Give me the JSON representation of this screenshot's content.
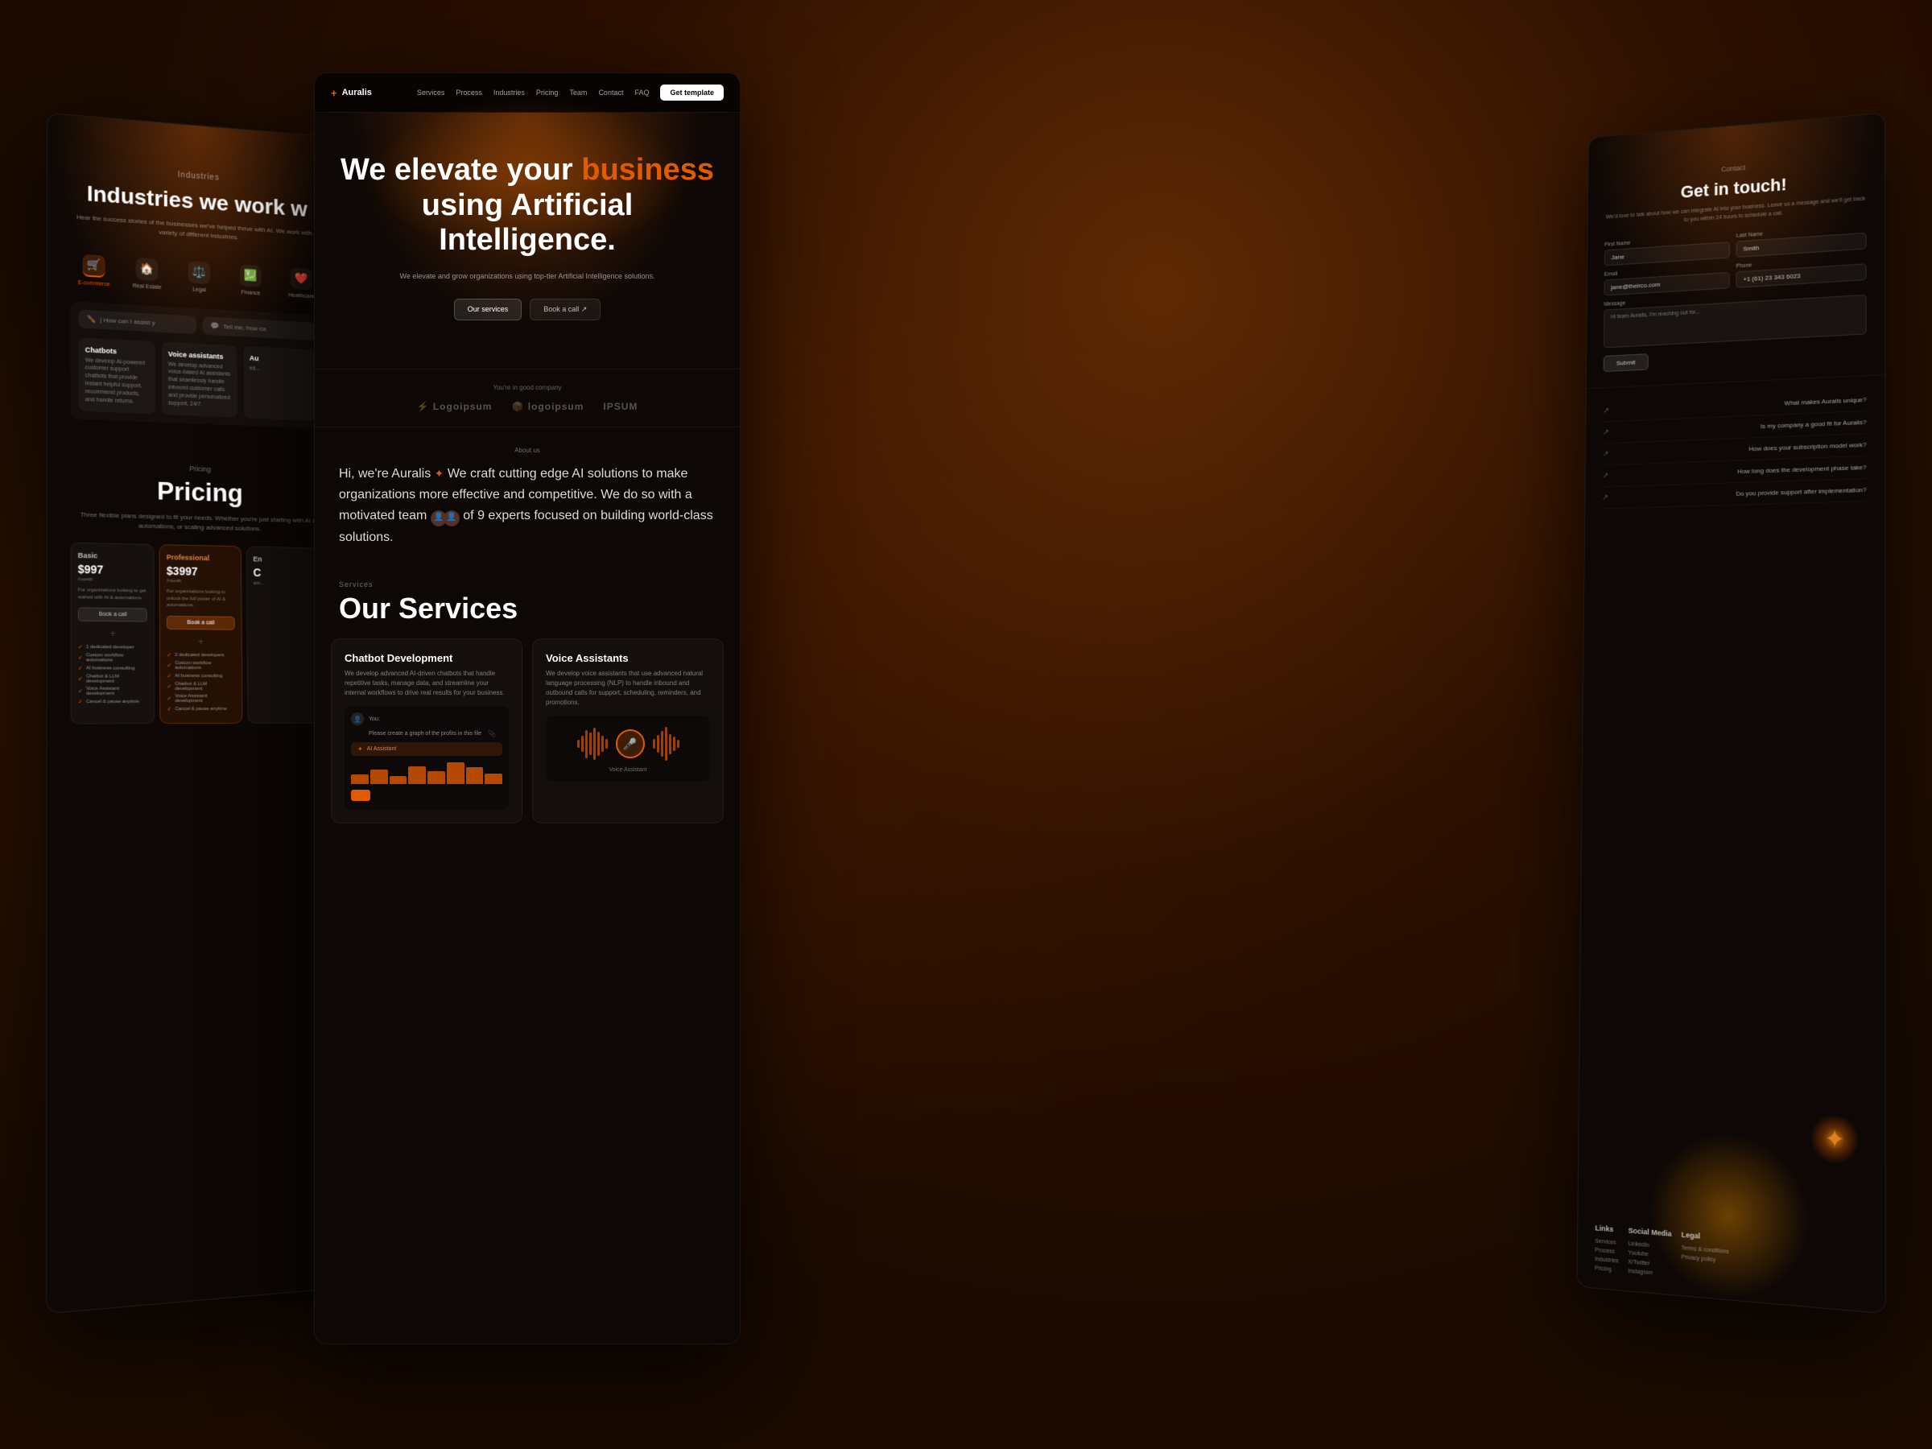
{
  "bg": {
    "desc": "Dark warm background with orange-brown glow"
  },
  "left_card": {
    "industries": {
      "label": "Industries",
      "title": "Industries we work w",
      "subtitle": "Hear the success stories of the businesses we've helped thrive with AI. We work with a variety of different industries.",
      "tabs": [
        {
          "label": "E-commerce",
          "icon": "🛒",
          "active": true
        },
        {
          "label": "Real Estate",
          "icon": "🏠",
          "active": false
        },
        {
          "label": "Legal",
          "icon": "⚖️",
          "active": false
        },
        {
          "label": "Finance",
          "icon": "💹",
          "active": false
        },
        {
          "label": "Healthcare",
          "icon": "❤️",
          "active": false
        }
      ],
      "chat_inputs": [
        {
          "icon": "✏️",
          "text": "| How can I assist y"
        },
        {
          "icon": "💬",
          "text": "Tell me, how ca"
        }
      ]
    },
    "services": {
      "chatbots": {
        "title": "Chatbots",
        "desc": "We develop AI-powered customer support chatbots that provide instant helpful support, recommend products, and handle returns."
      },
      "voice": {
        "title": "Voice assistants",
        "desc": "We develop advanced voice-based AI assistants that seamlessly handle inbound customer calls and provide personalized support, 24/7."
      },
      "automation": {
        "title": "Au",
        "desc": "ed..."
      }
    },
    "pricing": {
      "label": "Pricing",
      "title": "Pricing",
      "subtitle": "Three flexible plans designed to fit your needs. Whether you're just starting with AI & automations, or scaling advanced solutions.",
      "plans": [
        {
          "name": "Basic",
          "price": "$997",
          "period": "/month",
          "desc": "For organizations looking to get started with AI & automations.",
          "btn": "Book a call",
          "featured": false,
          "features": [
            "1 dedicated developer",
            "Custom workflow automations",
            "AI business consulting",
            "Chatbot & LLM development",
            "Voice Assistant development",
            "Cancel & pause anytime"
          ]
        },
        {
          "name": "Professional",
          "price": "$3997",
          "period": "/month",
          "desc": "For organizations looking to unlock the full power of AI & automations.",
          "btn": "Book a call",
          "featured": true,
          "features": [
            "2 dedicated developers",
            "Custom workflow automations",
            "AI business consulting",
            "Chatbot & LLM development",
            "Voice Assistant development",
            "Cancel & pause anytime"
          ]
        },
        {
          "name": "En",
          "price": "C",
          "period": "",
          "desc": "adv...",
          "btn": "",
          "featured": false,
          "features": []
        }
      ]
    }
  },
  "center_card": {
    "nav": {
      "logo": "Auralis",
      "logo_plus": "+",
      "links": [
        "Services",
        "Process",
        "Industries",
        "Pricing",
        "Team",
        "Contact",
        "FAQ"
      ],
      "cta": "Get template"
    },
    "hero": {
      "title_line1": "We elevate your ",
      "title_highlight": "business",
      "title_line2": "using Artificial Intelligence.",
      "subtitle": "We elevate and grow organizations using top-tier Artificial Intelligence solutions.",
      "btn_primary": "Our services",
      "btn_secondary": "Book a call ↗"
    },
    "partners": {
      "label": "You're in good company",
      "logos": [
        "Logoipsum",
        "logoipsum",
        "IPSUM"
      ]
    },
    "about": {
      "label": "About us",
      "text_part1": "Hi, we're Auralis ",
      "emoji": "✦",
      "text_part2": " We craft cutting edge AI solutions to make organizations more effective and competitive. We do so with a motivated team ",
      "experts_count": "of 9 experts",
      "text_part3": " focused on building world-class solutions."
    },
    "services": {
      "label": "Services",
      "title": "Our Services",
      "cards": [
        {
          "title": "Chatbot Development",
          "desc": "We develop advanced AI-driven chatbots that handle repetitive tasks, manage data, and streamline your internal workflows to drive real results for your business.",
          "demo_type": "chatbot",
          "user_text": "You:",
          "user_msg": "Please create a graph of the profits in this file",
          "ai_label": "AI Assistant"
        },
        {
          "title": "Voice Assistants",
          "desc": "We develop voice assistants that use advanced natural language processing (NLP) to handle inbound and outbound calls for support, scheduling, reminders, and promotions.",
          "demo_type": "voice",
          "voice_label": "Voice Assistant"
        }
      ]
    }
  },
  "right_card": {
    "contact": {
      "label": "Contact",
      "title": "Get in touch!",
      "subtitle": "We'd love to talk about how we can integrate AI into your business. Leave us a message and we'll get back to you within 24 hours to schedule a call.",
      "form": {
        "first_name_label": "First Name",
        "first_name_val": "Jane",
        "last_name_label": "Last Name",
        "last_name_val": "Smith",
        "email_label": "Email",
        "email_placeholder": "jane@theirco.com",
        "phone_label": "Phone",
        "phone_placeholder": "+1 (61) 23 343 6023",
        "message_label": "Message",
        "message_val": "Hi team Auralis, I'm reaching out for...",
        "submit_btn": "Submit"
      }
    },
    "faq": {
      "items": [
        "What makes Auralis unique?",
        "Is my company a good fit for Auralis?",
        "How does your subscription model work?",
        "How long does the development phase take?",
        "Do you provide support after implementation?"
      ]
    },
    "footer": {
      "links_col": {
        "title": "Links",
        "items": [
          "Services",
          "Process",
          "Industries",
          "Pricing"
        ]
      },
      "social_col": {
        "title": "Social Media",
        "items": [
          "LinkedIn",
          "Youtube",
          "X/Twitter",
          "Instagram"
        ]
      },
      "legal_col": {
        "title": "Legal",
        "items": [
          "Terms & conditions",
          "Privacy policy"
        ]
      }
    }
  }
}
